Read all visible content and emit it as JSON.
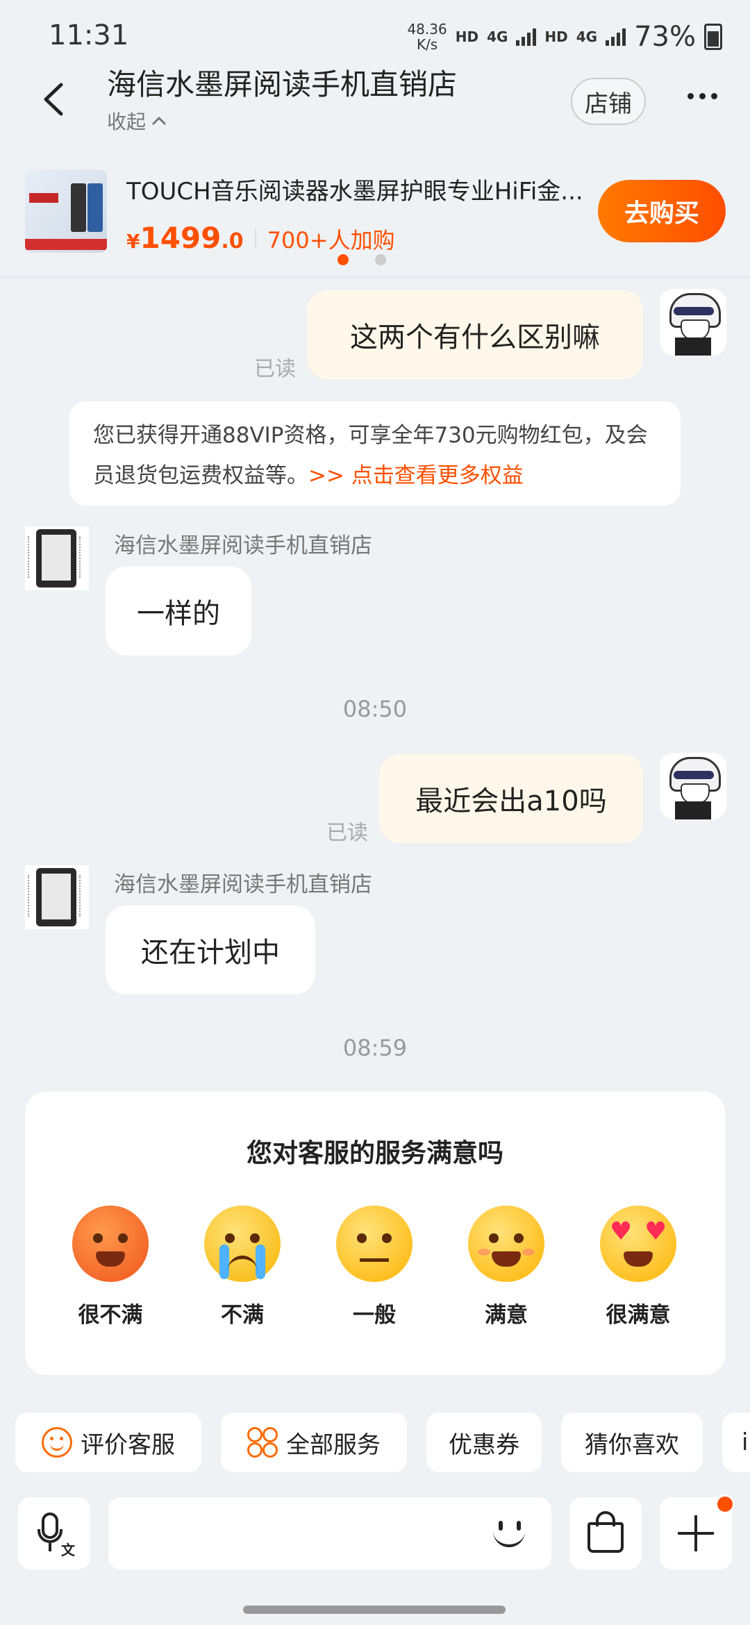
{
  "status_bar": {
    "time": "11:31",
    "net_speed_value": "48.36",
    "net_speed_unit": "K/s",
    "hd1": "HD",
    "net1": "4G",
    "hd2": "HD",
    "net2": "4G",
    "battery": "73%"
  },
  "header": {
    "title": "海信水墨屏阅读手机直销店",
    "collapse_label": "收起",
    "shop_button": "店铺"
  },
  "product": {
    "title": "TOUCH音乐阅读器水墨屏护眼专业HiFi金...",
    "price_currency": "¥",
    "price_main": "1499",
    "price_decimal": ".0",
    "buyers": "700+人加购",
    "buy_button": "去购买",
    "carousel_active_index": 0,
    "carousel_count": 2
  },
  "messages": {
    "m1_text": "这两个有什么区别嘛",
    "m1_read": "已读",
    "notice_text": "您已获得开通88VIP资格，可享全年730元购物红包，及会员退货包运费权益等。",
    "notice_link": ">> 点击查看更多权益",
    "shop_name_1": "海信水墨屏阅读手机直销店",
    "reply_1": "一样的",
    "time_1": "08:50",
    "m2_text": "最近会出a10吗",
    "m2_read": "已读",
    "shop_name_2": "海信水墨屏阅读手机直销店",
    "reply_2": "还在计划中",
    "time_2": "08:59"
  },
  "survey": {
    "title": "您对客服的服务满意吗",
    "options": [
      "很不满",
      "不满",
      "一般",
      "满意",
      "很满意"
    ]
  },
  "quick_actions": {
    "rate_service": "评价客服",
    "all_services": "全部服务",
    "coupons": "优惠券",
    "guess_like": "猜你喜欢",
    "partial": "i"
  },
  "input_bar": {
    "voice_badge": "文"
  },
  "colors": {
    "accent": "#ff5000",
    "my_bubble": "#fff8ea",
    "background": "#eef2f5"
  }
}
